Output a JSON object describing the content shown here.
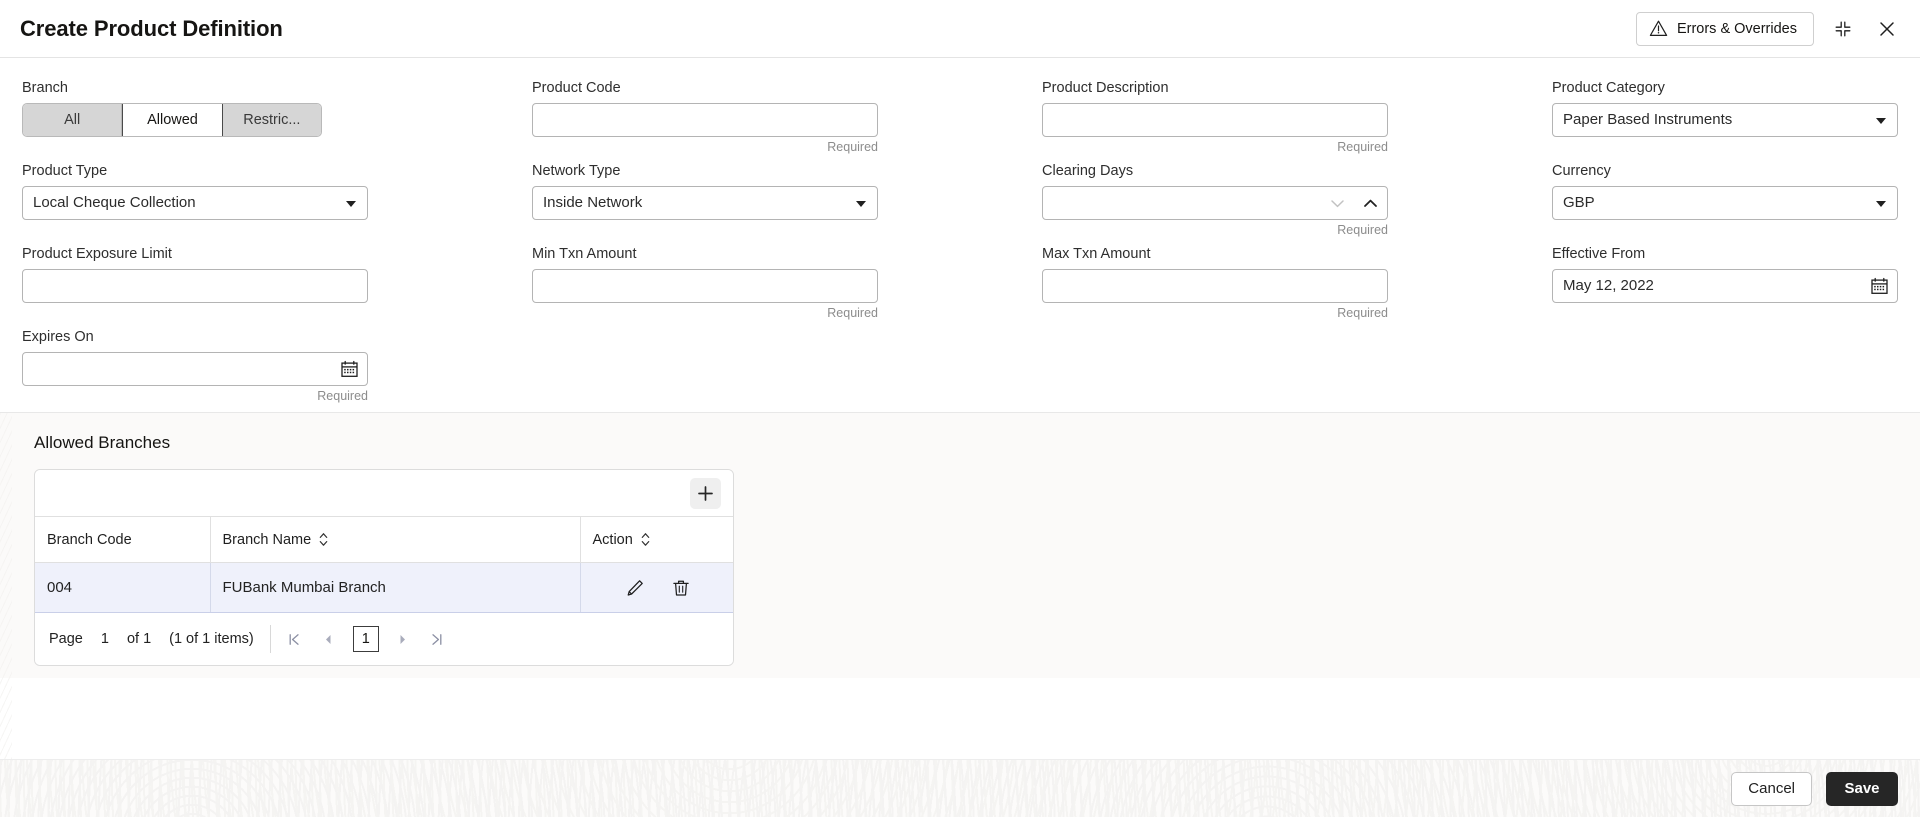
{
  "window": {
    "title": "Create Product Definition",
    "errors_button": "Errors & Overrides",
    "minimize_icon": "collapse-icon",
    "close_icon": "close-icon"
  },
  "form": {
    "branch": {
      "label": "Branch",
      "options": [
        "All",
        "Allowed",
        "Restric..."
      ],
      "selected": "Allowed"
    },
    "product_code": {
      "label": "Product Code",
      "value": "",
      "hint": "Required"
    },
    "product_description": {
      "label": "Product Description",
      "value": "",
      "hint": "Required"
    },
    "product_category": {
      "label": "Product Category",
      "value": "Paper Based Instruments",
      "hint": ""
    },
    "product_type": {
      "label": "Product Type",
      "value": "Local Cheque Collection",
      "hint": ""
    },
    "network_type": {
      "label": "Network Type",
      "value": "Inside Network",
      "hint": ""
    },
    "clearing_days": {
      "label": "Clearing Days",
      "value": "",
      "hint": "Required"
    },
    "currency": {
      "label": "Currency",
      "value": "GBP",
      "hint": ""
    },
    "product_exposure_limit": {
      "label": "Product Exposure Limit",
      "value": "",
      "hint": ""
    },
    "min_txn_amount": {
      "label": "Min Txn Amount",
      "value": "",
      "hint": "Required"
    },
    "max_txn_amount": {
      "label": "Max Txn Amount",
      "value": "",
      "hint": "Required"
    },
    "effective_from": {
      "label": "Effective From",
      "value": "May 12, 2022",
      "hint": ""
    },
    "expires_on": {
      "label": "Expires On",
      "value": "",
      "hint": "Required"
    }
  },
  "allowed_branches": {
    "title": "Allowed Branches",
    "add_icon": "plus-icon",
    "columns": [
      "Branch Code",
      "Branch Name",
      "Action"
    ],
    "rows": [
      {
        "branch_code": "004",
        "branch_name": "FUBank Mumbai Branch",
        "edit_icon": "pencil-icon",
        "delete_icon": "trash-icon"
      }
    ],
    "pagination": {
      "page_label": "Page",
      "page_number": "1",
      "of_label": "of 1",
      "items_label": "(1 of 1 items)",
      "current_page": "1",
      "first_icon": "first-page-icon",
      "prev_icon": "prev-page-icon",
      "next_icon": "next-page-icon",
      "last_icon": "last-page-icon"
    }
  },
  "footer": {
    "cancel_label": "Cancel",
    "save_label": "Save"
  },
  "colors": {
    "save_background": "#262626",
    "row_highlight": "#eff1fb",
    "hint_text": "#8c8c8c"
  }
}
